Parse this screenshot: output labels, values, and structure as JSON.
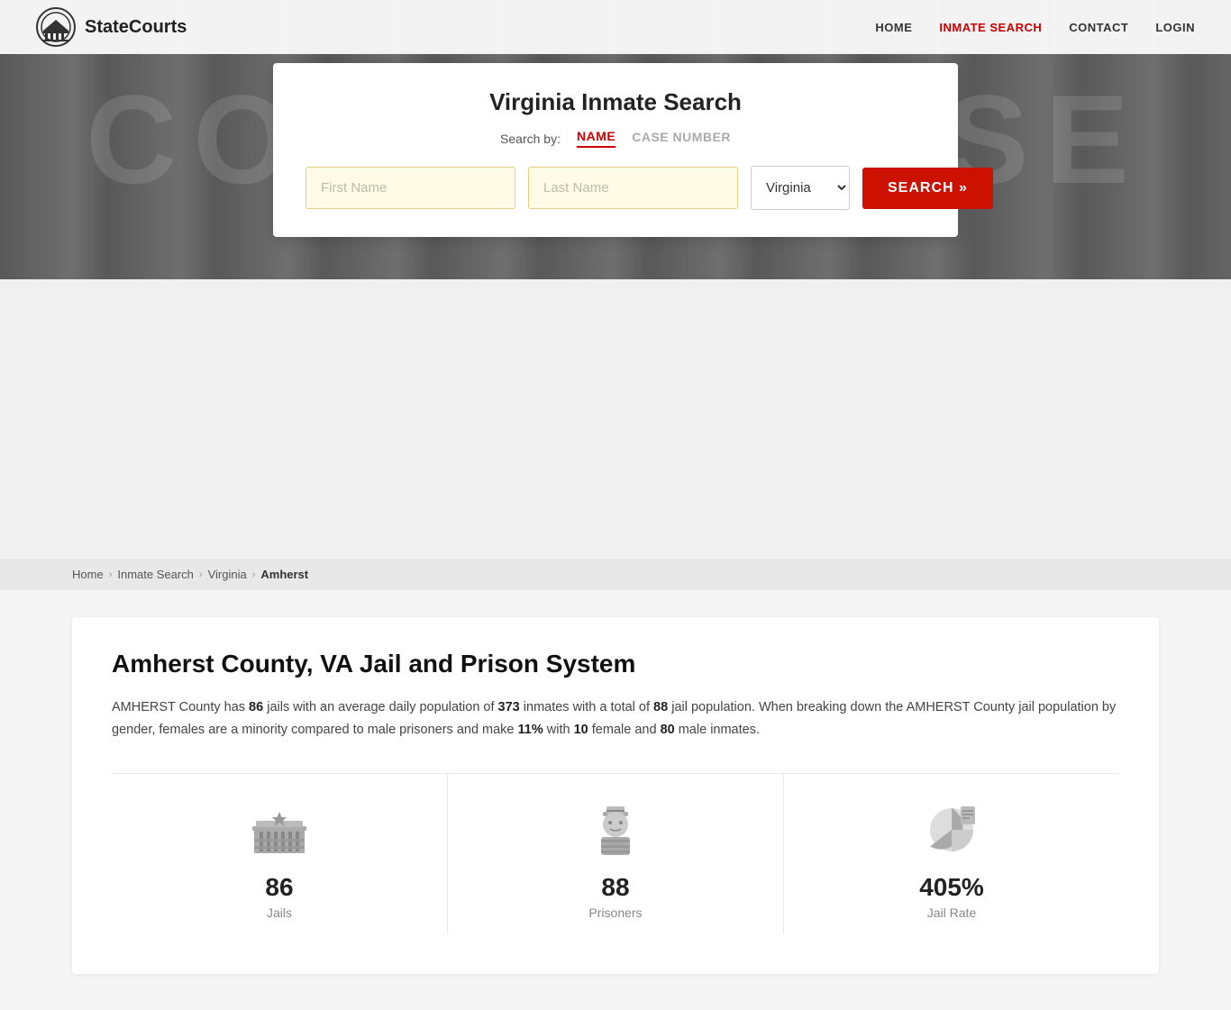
{
  "site": {
    "logo_text": "StateCourts",
    "courthouse_bg": "COURTHOUSE"
  },
  "nav": {
    "links": [
      {
        "id": "home",
        "label": "HOME",
        "active": false
      },
      {
        "id": "inmate-search",
        "label": "INMATE SEARCH",
        "active": true
      },
      {
        "id": "contact",
        "label": "CONTACT",
        "active": false
      },
      {
        "id": "login",
        "label": "LOGIN",
        "active": false
      }
    ]
  },
  "search_card": {
    "title": "Virginia Inmate Search",
    "search_by_label": "Search by:",
    "tabs": [
      {
        "id": "name",
        "label": "NAME",
        "active": true
      },
      {
        "id": "case-number",
        "label": "CASE NUMBER",
        "active": false
      }
    ],
    "first_name_placeholder": "First Name",
    "last_name_placeholder": "Last Name",
    "state_value": "Virginia",
    "search_button_label": "SEARCH »"
  },
  "breadcrumb": {
    "items": [
      {
        "label": "Home",
        "link": true
      },
      {
        "label": "Inmate Search",
        "link": true
      },
      {
        "label": "Virginia",
        "link": true
      },
      {
        "label": "Amherst",
        "link": false
      }
    ]
  },
  "content": {
    "title": "Amherst County, VA Jail and Prison System",
    "description_parts": [
      {
        "text": "AMHERST County has ",
        "bold": false
      },
      {
        "text": "86",
        "bold": true
      },
      {
        "text": " jails with an average daily population of ",
        "bold": false
      },
      {
        "text": "373",
        "bold": true
      },
      {
        "text": " inmates with a total of ",
        "bold": false
      },
      {
        "text": "88",
        "bold": true
      },
      {
        "text": " jail population. When breaking down the AMHERST County jail population by gender, females are a minority compared to male prisoners and make ",
        "bold": false
      },
      {
        "text": "11%",
        "bold": true
      },
      {
        "text": " with ",
        "bold": false
      },
      {
        "text": "10",
        "bold": true
      },
      {
        "text": " female and ",
        "bold": false
      },
      {
        "text": "80",
        "bold": true
      },
      {
        "text": " male inmates.",
        "bold": false
      }
    ],
    "stats": [
      {
        "id": "jails",
        "number": "86",
        "label": "Jails",
        "icon": "jail-building"
      },
      {
        "id": "prisoners",
        "number": "88",
        "label": "Prisoners",
        "icon": "prisoner"
      },
      {
        "id": "jail-rate",
        "number": "405%",
        "label": "Jail Rate",
        "icon": "chart-pie"
      }
    ]
  }
}
